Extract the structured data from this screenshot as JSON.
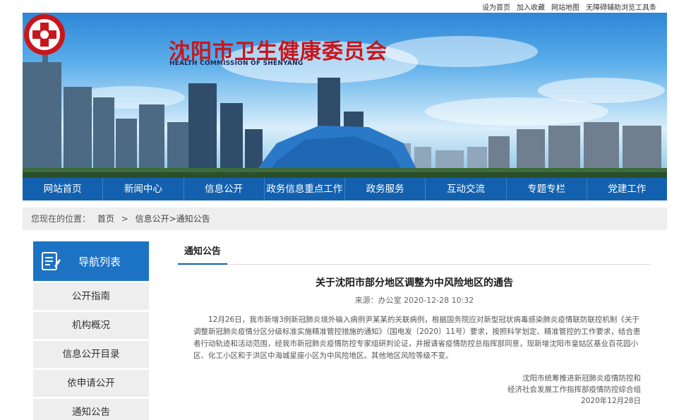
{
  "top_links": [
    "设为首页",
    "加入收藏",
    "网站地图",
    "无障碍辅助浏览工具条"
  ],
  "header": {
    "title": "沈阳市卫生健康委员会",
    "subtitle": "HEALTH COMMISSION OF SHENYANG"
  },
  "nav": [
    "网站首页",
    "新闻中心",
    "信息公开",
    "政务信息重点工作",
    "政务服务",
    "互动交流",
    "专题专栏",
    "党建工作"
  ],
  "breadcrumb": {
    "prefix": "您现在的位置：",
    "items": [
      "首页",
      ">",
      "信息公开",
      ">通知公告"
    ]
  },
  "sidebar": {
    "title": "导航列表",
    "items": [
      "公开指南",
      "机构概况",
      "信息公开目录",
      "依申请公开",
      "通知公告"
    ]
  },
  "content": {
    "tab": "通知公告",
    "title": "关于沈阳市部分地区调整为中风险地区的通告",
    "meta": "来源：办公室 2020-12-28 10:32",
    "body": "12月26日，我市新增3例新冠肺炎境外输入病例尹某某的关联病例，根据国务院应对新型冠状病毒感染肺炎疫情联防联控机制《关于调整新冠肺炎疫情分区分级标准实施精准管控措施的通知》（国电发〔2020〕11号）要求，按照科学划定、精准管控的工作要求，结合患者行动轨迹和活动范围，经我市新冠肺炎疫情防控专家组研判论证，并报请省疫情防控总指挥部同意，现新增沈阳市皇姑区基业百花园小区、化工小区和于洪区中海城星座小区为中风险地区。其他地区风险等级不变。",
    "signature": [
      "沈阳市统筹推进新冠肺炎疫情防控和",
      "经济社会发展工作指挥部疫情防控综合组",
      "2020年12月28日"
    ]
  },
  "colors": {
    "nav_bg": "#1361ae",
    "sidebar_head_bg": "#1c73c4",
    "title_red": "#c8161d",
    "light_gray": "#eeeeee"
  }
}
